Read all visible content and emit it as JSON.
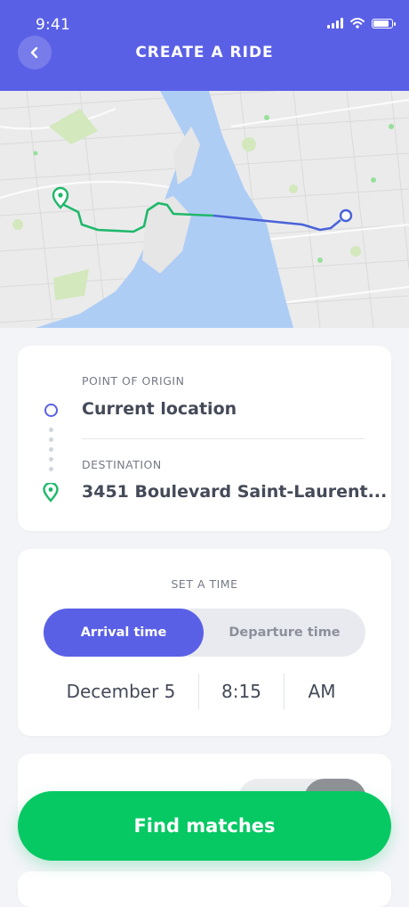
{
  "status": {
    "time": "9:41"
  },
  "header": {
    "title": "CREATE A RIDE"
  },
  "route": {
    "origin_label": "POINT OF ORIGIN",
    "origin_value": "Current location",
    "destination_label": "DESTINATION",
    "destination_value": "3451 Boulevard Saint-Laurent..."
  },
  "time": {
    "section_label": "SET A TIME",
    "options": [
      "Arrival time",
      "Departure time"
    ],
    "selected_option": "Arrival time",
    "date": "December 5",
    "clock": "8:15",
    "period": "AM"
  },
  "actions": {
    "find_label": "Find matches"
  },
  "colors": {
    "accent": "#5a60e6",
    "success": "#06c964",
    "map_water": "#aecdf5",
    "route_green": "#1fb86a"
  },
  "icons": [
    "back-chevron-icon",
    "signal-icon",
    "wifi-icon",
    "battery-icon",
    "origin-circle-icon",
    "destination-pin-icon"
  ]
}
